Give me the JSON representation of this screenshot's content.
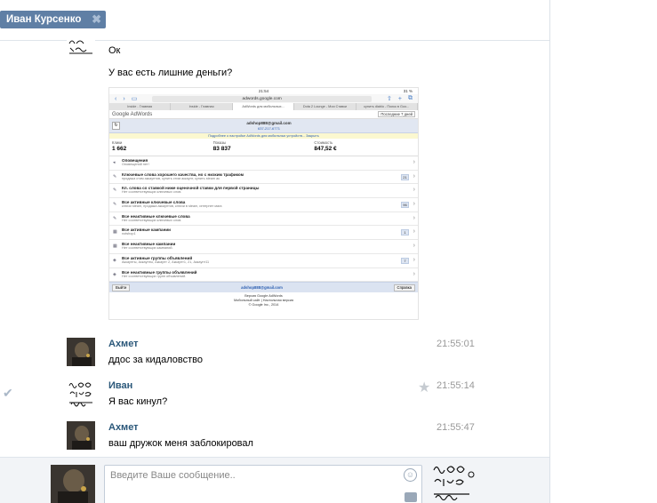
{
  "conversation": {
    "tab_label": "Иван Курсенко"
  },
  "messages": [
    {
      "author": "",
      "text": "Ок",
      "time": ""
    },
    {
      "author": "",
      "text": "У вас есть лишние деньги?",
      "time": ""
    },
    {
      "author": "Ахмет",
      "text": "ддос за кидаловство",
      "time": "21:55:01"
    },
    {
      "author": "Иван",
      "text": "Я вас кинул?",
      "time": "21:55:14"
    },
    {
      "author": "Ахмет",
      "text": "ваш дружок меня заблокировал",
      "time": "21:55:47"
    }
  ],
  "attachment": {
    "status_time": "21:54",
    "battery": "31 %",
    "url": "adwords.google.com",
    "tabs": [
      "Inside - Главная",
      "Inside - Главная",
      "AdWords для мобильных...",
      "Dota 2 Lounge - Мои Ставки",
      "купить diablo - Поиск в Goo..."
    ],
    "logo": "Google AdWords",
    "period": "Последние 7 дней",
    "account_email": "adshop888@gmail.com",
    "account_phone": "637-217-6771",
    "note": "Подробнее о настройке AdWords для мобильных устройств... Закрыть",
    "stats": [
      {
        "label": "Клики",
        "value": "1 662"
      },
      {
        "label": "Показы",
        "value": "83 837"
      },
      {
        "label": "Стоимость",
        "value": "847,52 €"
      }
    ],
    "rows": [
      {
        "title": "Оповещения",
        "sub": "Оповещений нет!",
        "badge": ""
      },
      {
        "title": "Ключевые слова хорошего качества, но с низким трафиком",
        "sub": "продажа стим аккаунтов, купить стим аккаунт, купить steam ак",
        "badge": "21"
      },
      {
        "title": "Кл. слова со ставкой ниже оценочной ставки для первой страницы",
        "sub": "Нет соответствующих ключевых слов.",
        "badge": ""
      },
      {
        "title": "Все активные ключевые слова",
        "sub": "ключи steam, продажа аккаунтов, ключи в steam, интернет мага",
        "badge": "96"
      },
      {
        "title": "Все неактивные ключевые слова",
        "sub": "Нет соответствующих ключевых слов.",
        "badge": ""
      },
      {
        "title": "Все активные кампании",
        "sub": "notshop1",
        "badge": "1"
      },
      {
        "title": "Все неактивные кампании",
        "sub": "Нет соответствующих кампаний.",
        "badge": ""
      },
      {
        "title": "Все активные группы объявлений",
        "sub": "Аккаунты, Аккаунты, Аккаунт 2, Аккаунт1, 21, Аккаунт11",
        "badge": "7"
      },
      {
        "title": "Все неактивные группы объявлений",
        "sub": "Нет соответствующих групп объявлений.",
        "badge": ""
      }
    ],
    "footer_left": "Выйти",
    "footer_email": "adshop888@gmail.com",
    "footer_right": "Справка",
    "copy1": "Версия Google AdWords",
    "copy2": "Мобильный сайт | Настольная версия",
    "copy3": "© Google Inc., 2014"
  },
  "composer": {
    "placeholder": "Введите Ваше сообщение.."
  }
}
